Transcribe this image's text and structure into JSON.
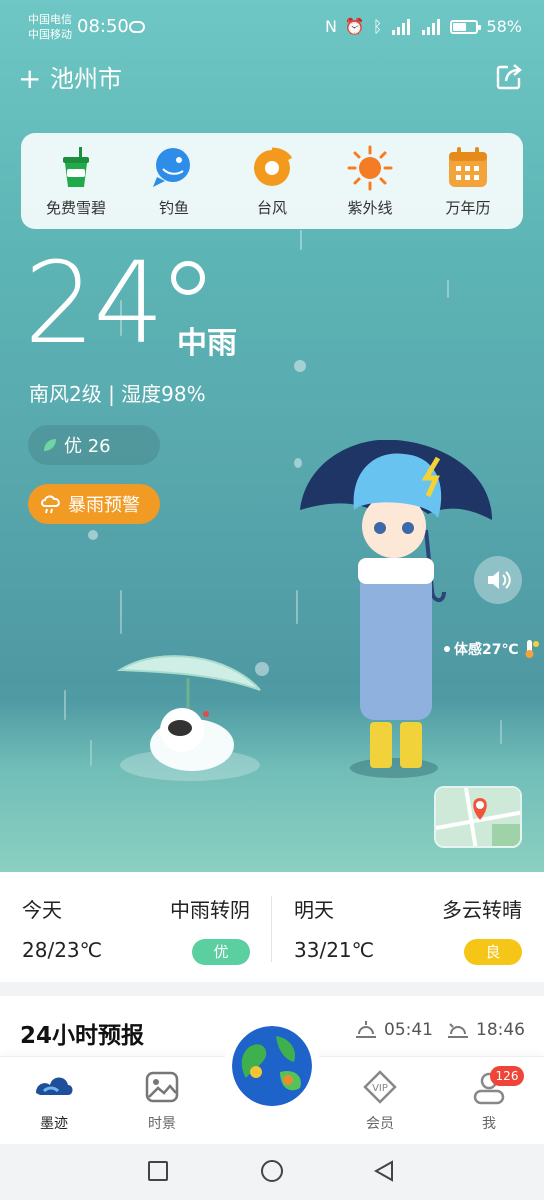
{
  "status_bar": {
    "carrier_1": "中国电信",
    "carrier_2": "中国移动",
    "time": "08:50",
    "battery_text": "58%",
    "battery_level": 0.58
  },
  "header": {
    "add_icon": "plus-icon",
    "city": "池州市",
    "share_icon": "share-icon"
  },
  "tools": [
    {
      "label": "免费雪碧",
      "icon": "sprite-cup-icon"
    },
    {
      "label": "钓鱼",
      "icon": "fish-icon"
    },
    {
      "label": "台风",
      "icon": "typhoon-icon"
    },
    {
      "label": "紫外线",
      "icon": "sun-icon"
    },
    {
      "label": "万年历",
      "icon": "calendar-icon"
    }
  ],
  "current": {
    "temperature": "24",
    "condition": "中雨",
    "wind_humidity": "南风2级 | 湿度98%",
    "aqi": "优 26",
    "warning": "暴雨预警",
    "feels_like": "体感27℃"
  },
  "today": {
    "name": "今天",
    "weather": "中雨转阴",
    "range": "28/23℃",
    "aqi": "优",
    "aqi_color": "#5ccfa0"
  },
  "tomorrow": {
    "name": "明天",
    "weather": "多云转晴",
    "range": "33/21℃",
    "aqi": "良",
    "aqi_color": "#f5c518"
  },
  "forecast": {
    "title": "24小时预报",
    "sunrise": "05:41",
    "sunset": "18:46"
  },
  "tabs": [
    {
      "label": "墨迹",
      "icon": "moji-cloud-icon"
    },
    {
      "label": "时景",
      "icon": "photo-icon"
    },
    {
      "label": "会员",
      "icon": "vip-icon"
    },
    {
      "label": "我",
      "icon": "user-icon"
    }
  ],
  "notification_count": "126",
  "colors": {
    "accent": "#f19a24",
    "sky": "#5db5b5"
  }
}
